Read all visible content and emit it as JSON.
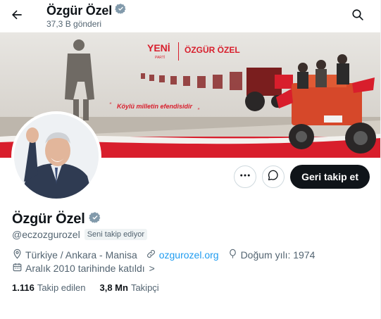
{
  "header": {
    "name": "Özgür Özel",
    "posts_count": "37,3 B gönderi"
  },
  "banner": {
    "logo_text": "YENİ",
    "logo_sub": "PARTİ",
    "name_text": "ÖZGÜR ÖZEL",
    "slogan": "Köylü milletin efendisidir"
  },
  "profile": {
    "name": "Özgür Özel",
    "handle": "@eczozgurozel",
    "follows_you": "Seni takip ediyor",
    "location": "Türkiye / Ankara - Manisa",
    "website": "ozgurozel.org",
    "birthday": "Doğum yılı: 1974",
    "joined": "Aralık 2010 tarihinde katıldı",
    "joined_chevron": ">"
  },
  "actions": {
    "follow_back_label": "Geri takip et"
  },
  "stats": {
    "following_count": "1.116",
    "following_label": "Takip edilen",
    "followers_count": "3,8 Mn",
    "followers_label": "Takipçi"
  },
  "icons": {
    "back": "arrow-left-icon",
    "search": "search-icon",
    "more": "more-horizontal-icon",
    "message": "message-icon",
    "verified": "verified-badge-icon",
    "location": "location-pin-icon",
    "link": "link-icon",
    "birthday": "balloon-icon",
    "calendar": "calendar-icon"
  },
  "colors": {
    "accent": "#1d9bf0",
    "text_primary": "#0f1419",
    "text_secondary": "#536471",
    "verified": "#829aab",
    "banner_red": "#d81e2c"
  }
}
